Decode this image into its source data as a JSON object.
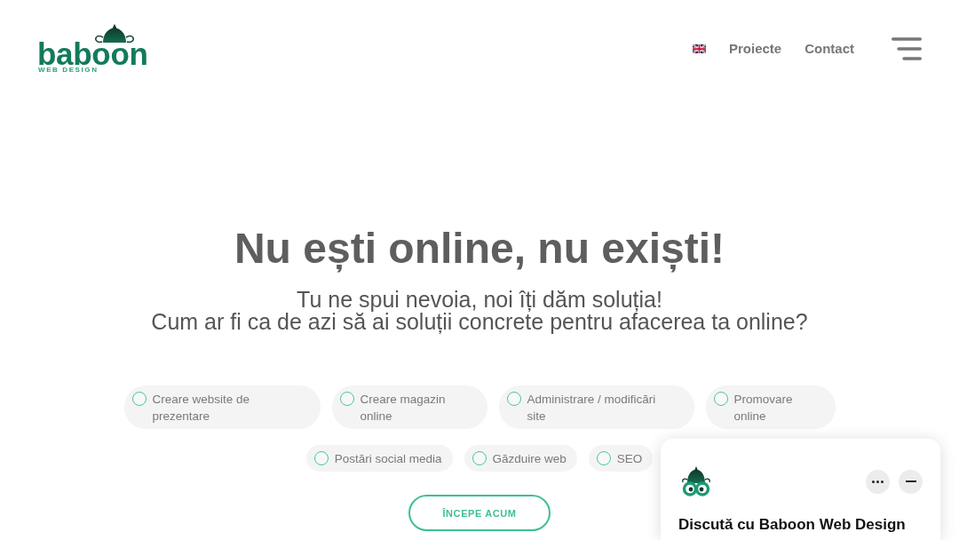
{
  "header": {
    "logo": {
      "wordmark": "baboon",
      "tagline": "WEB DESIGN"
    },
    "nav": [
      {
        "label": "Proiecte"
      },
      {
        "label": "Contact"
      }
    ]
  },
  "hero": {
    "title": "Nu ești online, nu exiști!",
    "subtitle": [
      "Tu ne spui nevoia, noi îți dăm soluția!",
      "Cum ar fi ca de azi să ai soluții concrete pentru afacerea ta online?"
    ]
  },
  "services": [
    {
      "label": "Creare website de prezentare",
      "selected": false
    },
    {
      "label": "Creare magazin online",
      "selected": false
    },
    {
      "label": "Administrare / modificări site",
      "selected": false
    },
    {
      "label": "Promovare online",
      "selected": false
    },
    {
      "label": "Postări social media",
      "selected": false
    },
    {
      "label": "Găzduire web",
      "selected": false
    },
    {
      "label": "SEO",
      "selected": false
    }
  ],
  "cta": {
    "label": "ÎNCEPE ACUM"
  },
  "chat_widget": {
    "title": "Discută cu Baboon Web Design"
  }
}
